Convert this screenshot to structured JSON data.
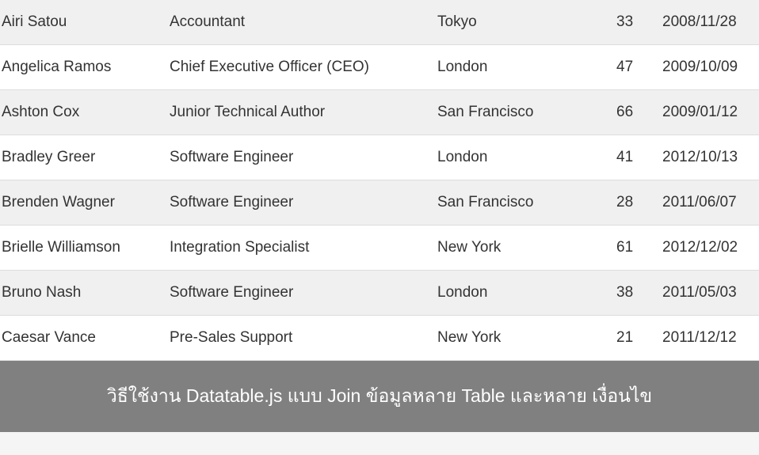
{
  "table": {
    "rows": [
      {
        "name": "Airi Satou",
        "position": "Accountant",
        "city": "Tokyo",
        "age": "33",
        "date": "2008/11/28"
      },
      {
        "name": "Angelica Ramos",
        "position": "Chief Executive Officer (CEO)",
        "city": "London",
        "age": "47",
        "date": "2009/10/09"
      },
      {
        "name": "Ashton Cox",
        "position": "Junior Technical Author",
        "city": "San Francisco",
        "age": "66",
        "date": "2009/01/12"
      },
      {
        "name": "Bradley Greer",
        "position": "Software Engineer",
        "city": "London",
        "age": "41",
        "date": "2012/10/13"
      },
      {
        "name": "Brenden Wagner",
        "position": "Software Engineer",
        "city": "San Francisco",
        "age": "28",
        "date": "2011/06/07"
      },
      {
        "name": "Brielle Williamson",
        "position": "Integration Specialist",
        "city": "New York",
        "age": "61",
        "date": "2012/12/02"
      },
      {
        "name": "Bruno Nash",
        "position": "Software Engineer",
        "city": "London",
        "age": "38",
        "date": "2011/05/03"
      },
      {
        "name": "Caesar Vance",
        "position": "Pre-Sales Support",
        "city": "New York",
        "age": "21",
        "date": "2011/12/12"
      }
    ]
  },
  "caption": "วิธีใช้งาน Datatable.js แบบ Join ข้อมูลหลาย Table และหลาย เงื่อนไข"
}
